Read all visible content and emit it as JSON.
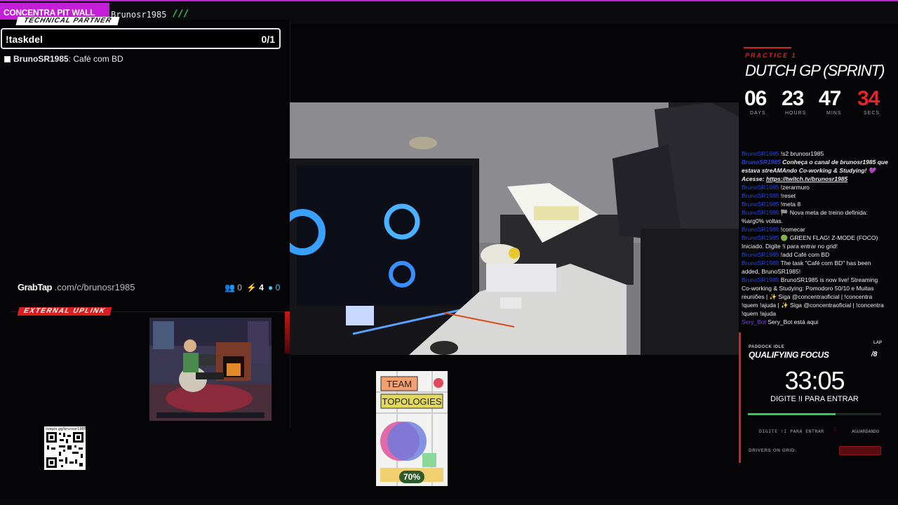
{
  "topbar": {
    "brand": "CONCENTRA PIT WALL",
    "handle": "Brunosr1985",
    "separator": "///"
  },
  "tasks": {
    "badge": "TECHNICAL PARTNER",
    "command": "!taskdel",
    "count": "0/1",
    "items": [
      {
        "user": "BrunoSR1985",
        "text": ": Café com BD",
        "checked": false
      }
    ]
  },
  "grabtap": {
    "logo": "GrabTap",
    "url": ".com/c/brunosr1985",
    "users": "0",
    "boosts": "4",
    "coins": "0"
  },
  "uplink": {
    "badge": "EXTERNAL UPLINK"
  },
  "qr": {
    "url": "livepix.gg/brunosr1985"
  },
  "book": {
    "line1": "TEAM",
    "line2": "TOPOLOGIES",
    "progress": "70%"
  },
  "countdown": {
    "session": "PRACTICE 1",
    "event": "DUTCH GP (SPRINT)",
    "units": [
      {
        "value": "06",
        "label": "DAYS"
      },
      {
        "value": "23",
        "label": "HOURS"
      },
      {
        "value": "47",
        "label": "MINS"
      },
      {
        "value": "34",
        "label": "SECS"
      }
    ]
  },
  "chat": [
    {
      "user": "BrunoSR1985",
      "text": "!s2 brunosr1985"
    },
    {
      "user": "BrunoSR1985",
      "text": "Conheça o canal de brunosr1985 que estava streAMAndo Co-working & Studying! 💜 Acesse: ",
      "link": "https://twitch.tv/brunosr1985",
      "style": "bold-it"
    },
    {
      "user": "BrunoSR1985",
      "text": "!zerarmuro"
    },
    {
      "user": "BrunoSR1985",
      "text": "!reset"
    },
    {
      "user": "BrunoSR1985",
      "text": "!meta 8"
    },
    {
      "user": "BrunoSR1985",
      "text": "🏁 Nova meta de treino definida: %arg0% voltas."
    },
    {
      "user": "BrunoSR1985",
      "text": "!comecar"
    },
    {
      "user": "BrunoSR1985",
      "text": "🟢 GREEN FLAG! Z-MODE (FOCO) Iniciado. Digite !i para entrar no grid!"
    },
    {
      "user": "BrunoSR1985",
      "text": "!add Café com BD"
    },
    {
      "user": "BrunoSR1985",
      "text": "The task \"Café com BD\" has been added, BrunoSR1985!"
    },
    {
      "user": "BrunoSR1985",
      "text": "BrunoSR1985 is now live! Streaming Co-working & Studying: Pomodoro 50/10 e Muitas reuniões | ✨ Siga @concentraoficial | !concentra !quem !ajuda | ✨ Siga @concentraoficial | !concentra !quem !ajuda"
    },
    {
      "user": "Sery_Bot",
      "text": "Sery_Bot está aqui",
      "alt": true
    }
  ],
  "quali": {
    "paddock": "PADDOCK IDLE",
    "lap_label": "LAP",
    "lap_value": "/8",
    "title": "QUALIFYING FOCUS",
    "timer": "33:05",
    "hint": "DIGITE !I PARA ENTRAR",
    "progress": 0.66,
    "status_left": "DIGITE !I PARA ENTRAR",
    "status_sep": "//",
    "status_right": "AGUARDANDO",
    "drivers_label": "DRIVERS ON GRID:"
  },
  "colors": {
    "accent": "#c21fd6",
    "red": "#d2242a",
    "green": "#2ecc55"
  }
}
